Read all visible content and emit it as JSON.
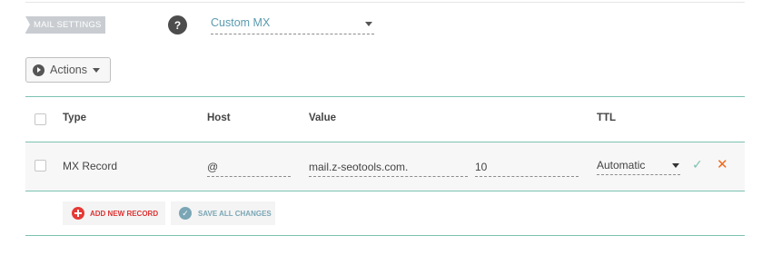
{
  "mail_settings": {
    "label": "MAIL SETTINGS",
    "help_glyph": "?",
    "mode_selected": "Custom MX"
  },
  "toolbar": {
    "actions_label": "Actions"
  },
  "table": {
    "headers": {
      "type": "Type",
      "host": "Host",
      "value": "Value",
      "ttl": "TTL"
    },
    "rows": [
      {
        "type": "MX Record",
        "host": "@",
        "value": "mail.z-seotools.com.",
        "priority": "10",
        "ttl": "Automatic"
      }
    ]
  },
  "buttons": {
    "add_new_record": "ADD NEW RECORD",
    "save_all_changes": "SAVE ALL CHANGES"
  },
  "icons": {
    "confirm": "✓",
    "delete": "✕"
  },
  "colors": {
    "accent_teal": "#7bc2b0",
    "delete_orange": "#f06a1a",
    "add_red": "#e53935",
    "select_blue": "#5a9bb0"
  }
}
